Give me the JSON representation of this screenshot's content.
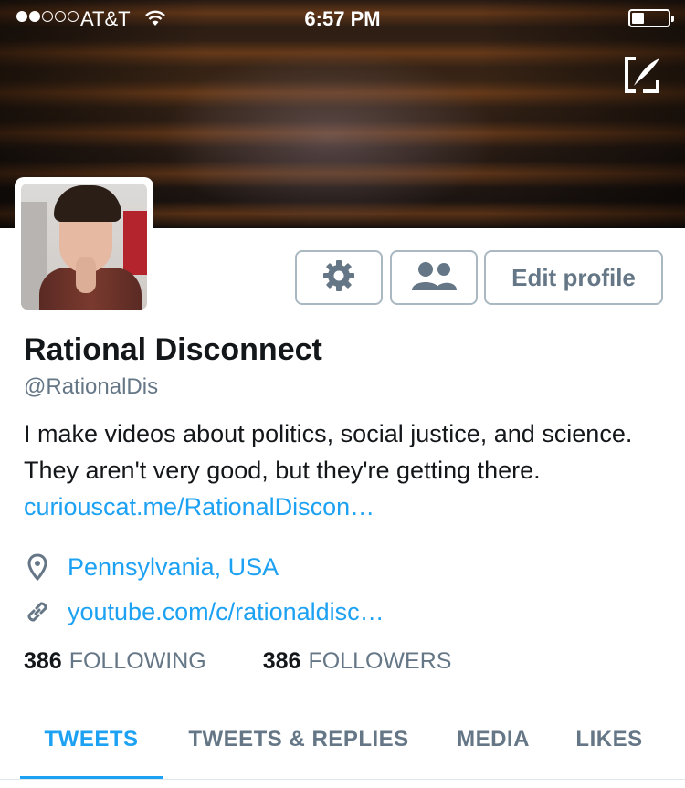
{
  "status_bar": {
    "carrier": "AT&T",
    "time": "6:57 PM",
    "signal_bars": 2,
    "signal_total": 5,
    "battery_level": 0.35
  },
  "profile": {
    "name": "Rational Disconnect",
    "handle": "@RationalDis",
    "bio_text": "I make videos about politics, social justice, and science. They aren't very good, but they're getting there.",
    "bio_link": "curiouscat.me/RationalDiscon…",
    "location": "Pennsylvania, USA",
    "website": "youtube.com/c/rationaldisc…"
  },
  "buttons": {
    "settings_icon": "gear-icon",
    "people_icon": "people-icon",
    "edit_label": "Edit profile"
  },
  "counts": {
    "following_num": "386",
    "following_label": "FOLLOWING",
    "followers_num": "386",
    "followers_label": "FOLLOWERS"
  },
  "tabs": [
    {
      "label": "TWEETS",
      "active": true
    },
    {
      "label": "TWEETS & REPLIES",
      "active": false
    },
    {
      "label": "MEDIA",
      "active": false
    },
    {
      "label": "LIKES",
      "active": false
    }
  ],
  "colors": {
    "accent": "#1da1f2",
    "muted": "#657786",
    "text": "#14171a"
  }
}
